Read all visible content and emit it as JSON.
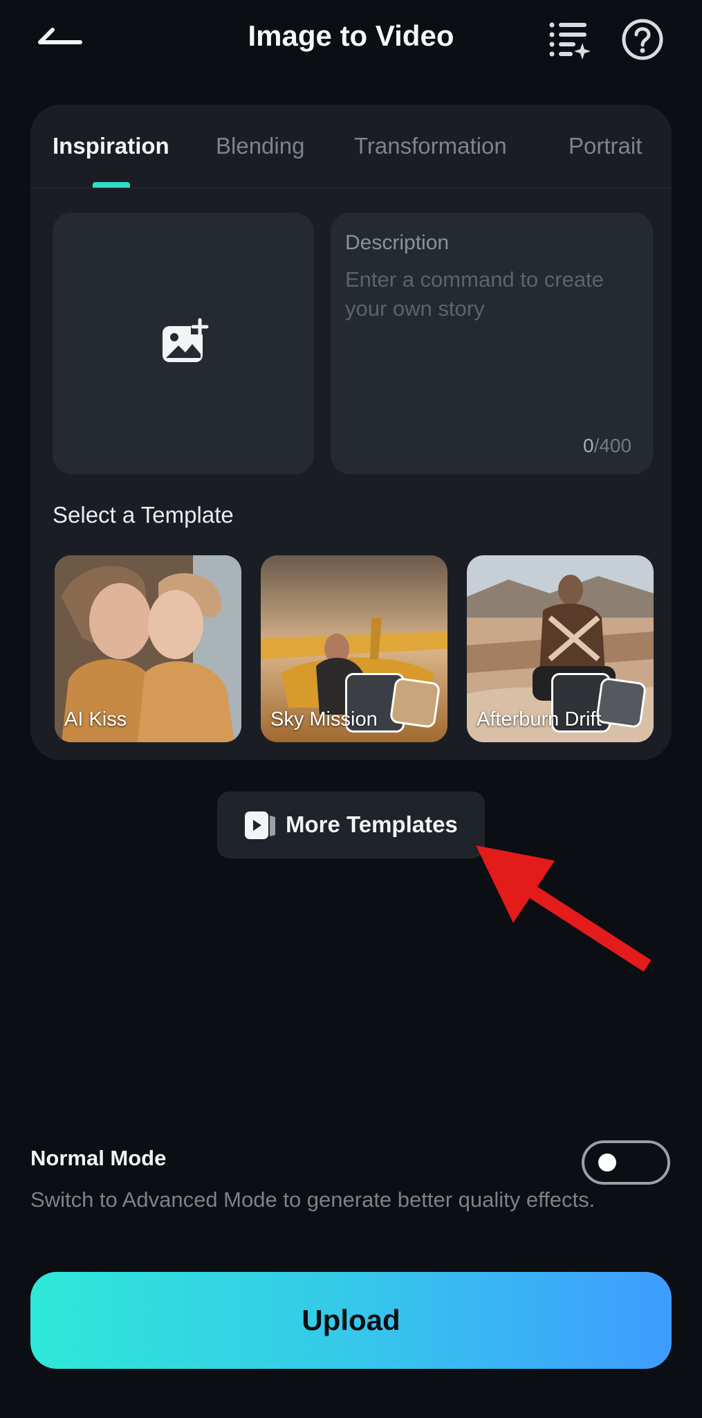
{
  "header": {
    "title": "Image to Video",
    "back_icon": "back-arrow-icon",
    "list_icon": "sparkle-list-icon",
    "help_icon": "help-circle-icon"
  },
  "tabs": [
    {
      "label": "Inspiration",
      "active": true
    },
    {
      "label": "Blending",
      "active": false
    },
    {
      "label": "Transformation",
      "active": false
    },
    {
      "label": "Portrait",
      "active": false
    }
  ],
  "upload_box": {
    "icon": "add-image-icon"
  },
  "description": {
    "label": "Description",
    "placeholder": "Enter a command to create your own story",
    "count_current": "0",
    "count_max": "/400"
  },
  "templates": {
    "heading": "Select a Template",
    "items": [
      {
        "name": "AI Kiss"
      },
      {
        "name": "Sky Mission"
      },
      {
        "name": "Afterburn Drift"
      }
    ]
  },
  "more_templates": {
    "label": "More Templates",
    "icon": "video-play-icon"
  },
  "mode": {
    "title": "Normal Mode",
    "description": "Switch to Advanced Mode to generate better quality effects.",
    "enabled": false
  },
  "upload_button": {
    "label": "Upload"
  },
  "colors": {
    "accent": "#2fe0c6",
    "background": "#0b0e12",
    "card": "#1a1e24",
    "annotation_arrow": "#e31b1b"
  }
}
